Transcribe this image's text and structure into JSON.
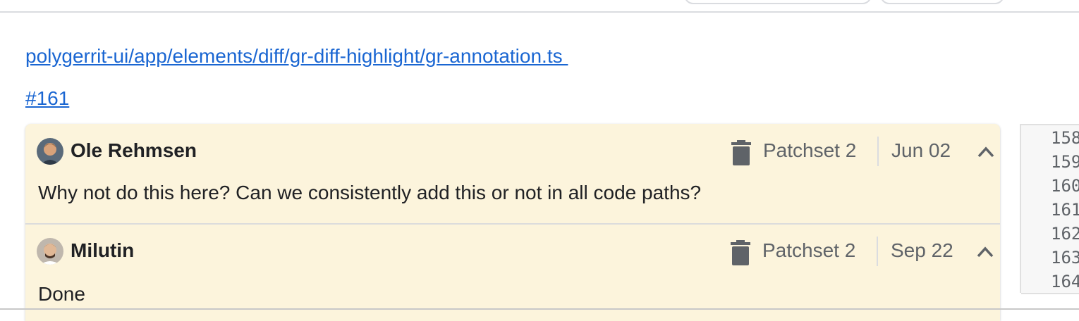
{
  "file": {
    "path": "polygerrit-ui/app/elements/diff/gr-diff-highlight/gr-annotation.ts ",
    "line_link": "#161"
  },
  "thread": {
    "comments": [
      {
        "author": "Ole Rehmsen",
        "patchset": "Patchset 2",
        "date": "Jun 02",
        "message": "Why not do this here? Can we consistently add this or not in all code paths?"
      },
      {
        "author": "Milutin",
        "patchset": "Patchset 2",
        "date": "Sep 22",
        "message": "Done"
      }
    ]
  },
  "code": {
    "line_numbers": [
      "158",
      "159",
      "160",
      "161",
      "162",
      "163",
      "164"
    ]
  },
  "icons": {
    "delete": "trash-icon",
    "collapse": "chevron-up-icon",
    "avatar": "user-avatar"
  },
  "colors": {
    "link": "#1a66d2",
    "comment_bg": "#fcf4dc",
    "meta_text": "#5f6368"
  }
}
